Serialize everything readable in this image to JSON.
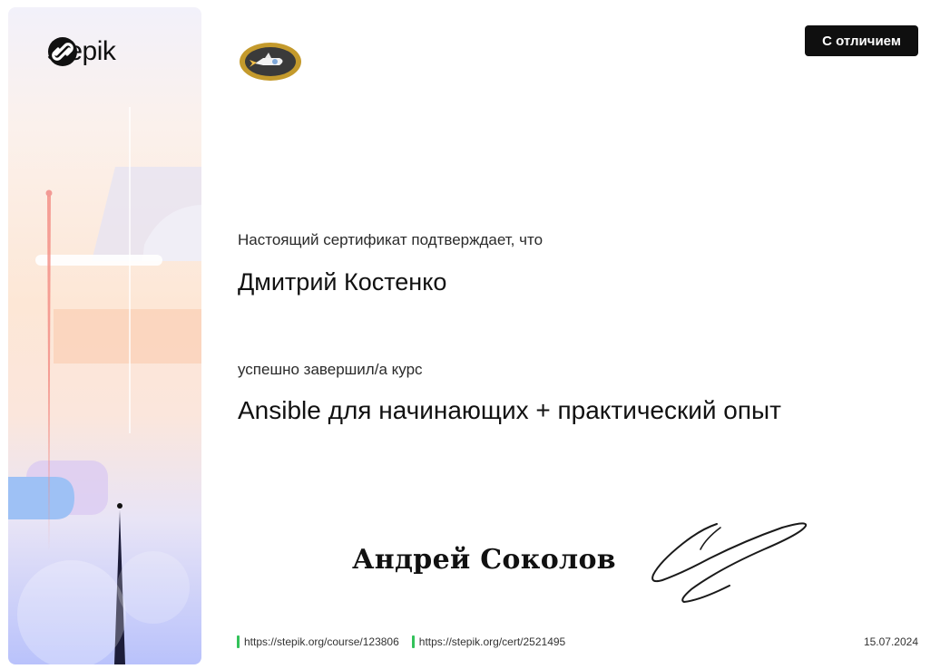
{
  "brand": {
    "name": "stepik"
  },
  "icons": {
    "brand": "stepik-logo-icon",
    "badge": "rocket-badge-icon",
    "signature": "signature-icon"
  },
  "colors": {
    "link_marker": "#33c25a",
    "distinction_bg": "#0f0f0f"
  },
  "certificate": {
    "distinction": "С отличием",
    "confirm_text": "Настоящий сертификат подтверждает, что",
    "recipient": "Дмитрий Костенко",
    "completed_text": "успешно завершил/а  курс",
    "course": "Ansible для начинающих + практический опыт",
    "signer": "Андрей Соколов"
  },
  "footer": {
    "course_url": "https://stepik.org/course/123806",
    "cert_url": "https://stepik.org/cert/2521495",
    "date": "15.07.2024"
  }
}
